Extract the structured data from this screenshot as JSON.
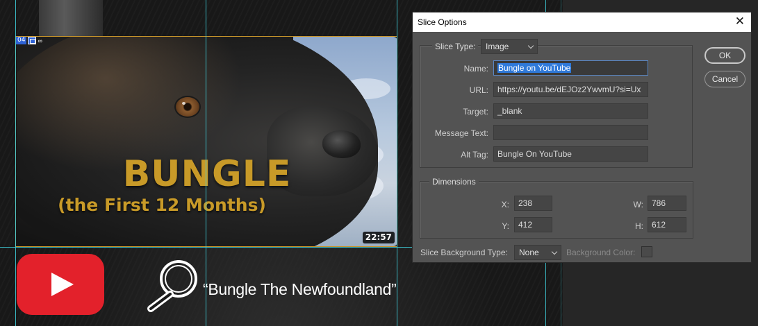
{
  "canvas": {
    "slice_number": "04",
    "thumbnail": {
      "title": "BUNGLE",
      "subtitle": "(the First 12 Months)",
      "duration": "22:57"
    },
    "search_phrase": "“Bungle The Newfoundland”"
  },
  "dialog": {
    "title": "Slice Options",
    "close_glyph": "✕",
    "slice_type": {
      "label": "Slice Type:",
      "value": "Image"
    },
    "fields": {
      "name": {
        "label": "Name:",
        "value": "Bungle on YouTube"
      },
      "url": {
        "label": "URL:",
        "value": "https://youtu.be/dEJOz2YwvmU?si=Ux"
      },
      "target": {
        "label": "Target:",
        "value": "_blank"
      },
      "message_text": {
        "label": "Message Text:",
        "value": ""
      },
      "alt_tag": {
        "label": "Alt Tag:",
        "value": "Bungle On YouTube"
      }
    },
    "dimensions": {
      "label": "Dimensions",
      "x": {
        "label": "X:",
        "value": "238"
      },
      "y": {
        "label": "Y:",
        "value": "412"
      },
      "w": {
        "label": "W:",
        "value": "786"
      },
      "h": {
        "label": "H:",
        "value": "612"
      }
    },
    "background": {
      "type_label": "Slice Background Type:",
      "type_value": "None",
      "color_label": "Background Color:"
    },
    "buttons": {
      "ok": "OK",
      "cancel": "Cancel"
    }
  },
  "colors": {
    "slice_border": "#c8952a",
    "guides": "#3fd4e0",
    "title_gold": "#c89a28",
    "youtube_red": "#e3212b",
    "selection_blue": "#2f79d9"
  }
}
